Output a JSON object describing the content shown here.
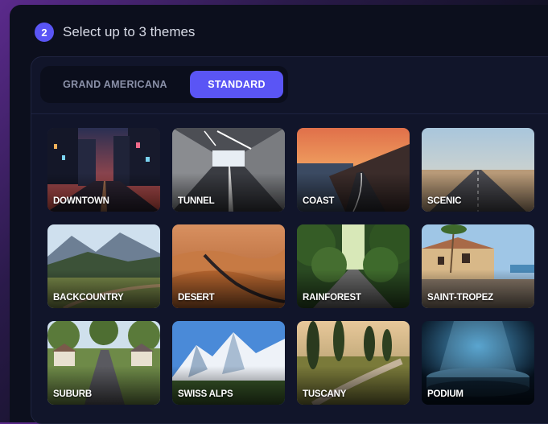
{
  "step": {
    "number": "2",
    "title": "Select up to 3 themes"
  },
  "tabs": [
    {
      "label": "GRAND AMERICANA",
      "active": false
    },
    {
      "label": "STANDARD",
      "active": true
    }
  ],
  "themes": [
    {
      "label": "DOWNTOWN",
      "icon": "city-night-street-image"
    },
    {
      "label": "TUNNEL",
      "icon": "tunnel-road-image"
    },
    {
      "label": "COAST",
      "icon": "coastal-road-sunset-image"
    },
    {
      "label": "SCENIC",
      "icon": "open-highway-image"
    },
    {
      "label": "BACKCOUNTRY",
      "icon": "mountain-meadow-image"
    },
    {
      "label": "DESERT",
      "icon": "desert-dunes-road-image"
    },
    {
      "label": "RAINFOREST",
      "icon": "forest-road-image"
    },
    {
      "label": "SAINT-TROPEZ",
      "icon": "mediterranean-villa-image"
    },
    {
      "label": "SUBURB",
      "icon": "suburban-street-image"
    },
    {
      "label": "SWISS ALPS",
      "icon": "snowy-alps-image"
    },
    {
      "label": "TUSCANY",
      "icon": "tuscan-cypress-road-image"
    },
    {
      "label": "PODIUM",
      "icon": "spotlight-podium-image"
    }
  ]
}
